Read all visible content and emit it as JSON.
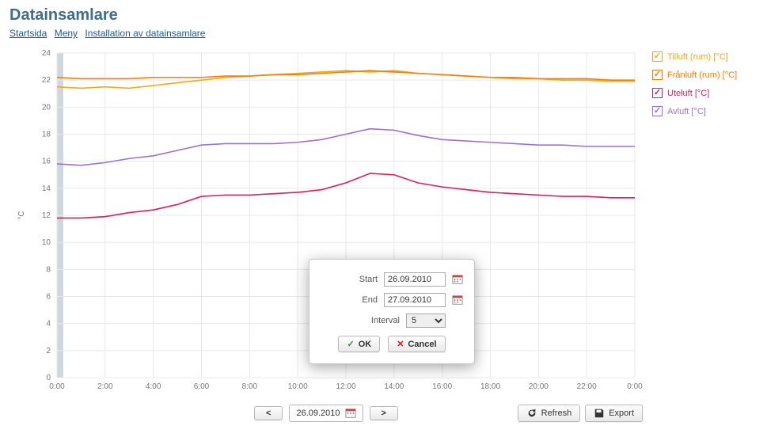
{
  "title": "Datainsamlare",
  "breadcrumbs": [
    {
      "label": "Startsida"
    },
    {
      "label": "Meny"
    },
    {
      "label": "Installation av datainsamlare"
    }
  ],
  "legend": [
    {
      "label": "Tilluft (rum) [°C]",
      "color": "#f4a90d"
    },
    {
      "label": "Frånluft (rum) [°C]",
      "color": "#ff7b00"
    },
    {
      "label": "Uteluft [°C]",
      "color": "#e11a5a"
    },
    {
      "label": "Avluft [°C]",
      "color": "#9b6fe0"
    }
  ],
  "chart_data": {
    "type": "line",
    "xlabel": "",
    "ylabel": "°C",
    "ylim": [
      0,
      24
    ],
    "yticks": [
      0,
      2,
      4,
      6,
      8,
      10,
      12,
      14,
      16,
      18,
      20,
      22,
      24
    ],
    "xcategories": [
      "0:00",
      "2:00",
      "4:00",
      "6:00",
      "8:00",
      "10:00",
      "12:00",
      "14:00",
      "16:00",
      "18:00",
      "20:00",
      "22:00",
      "0:00"
    ],
    "series": [
      {
        "name": "Tilluft (rum) [°C]",
        "color": "#f4a90d",
        "values": [
          21.5,
          21.4,
          21.5,
          21.4,
          21.6,
          21.8,
          22.0,
          22.2,
          22.3,
          22.4,
          22.5,
          22.6,
          22.7,
          22.6,
          22.7,
          22.5,
          22.4,
          22.3,
          22.2,
          22.1,
          22.1,
          22.0,
          22.0,
          21.9,
          21.9
        ]
      },
      {
        "name": "Frånluft (rum) [°C]",
        "color": "#ff7b00",
        "values": [
          22.2,
          22.1,
          22.1,
          22.1,
          22.2,
          22.2,
          22.2,
          22.3,
          22.3,
          22.4,
          22.4,
          22.5,
          22.6,
          22.7,
          22.6,
          22.5,
          22.4,
          22.3,
          22.2,
          22.2,
          22.1,
          22.1,
          22.1,
          22.0,
          22.0
        ]
      },
      {
        "name": "Uteluft [°C]",
        "color": "#e11a5a",
        "values": [
          11.8,
          11.8,
          11.9,
          12.2,
          12.4,
          12.8,
          13.4,
          13.5,
          13.5,
          13.6,
          13.7,
          13.9,
          14.4,
          15.1,
          15.0,
          14.4,
          14.1,
          13.9,
          13.7,
          13.6,
          13.5,
          13.4,
          13.4,
          13.3,
          13.3
        ]
      },
      {
        "name": "Avluft [°C]",
        "color": "#9b6fe0",
        "values": [
          15.8,
          15.7,
          15.9,
          16.2,
          16.4,
          16.8,
          17.2,
          17.3,
          17.3,
          17.3,
          17.4,
          17.6,
          18.0,
          18.4,
          18.3,
          17.9,
          17.6,
          17.5,
          17.4,
          17.3,
          17.2,
          17.2,
          17.1,
          17.1,
          17.1
        ]
      }
    ]
  },
  "toolbar": {
    "prev": "<",
    "date": "26.09.2010",
    "next": ">",
    "refresh": "Refresh",
    "export": "Export"
  },
  "dialog": {
    "start_label": "Start",
    "start_value": "26.09.2010",
    "end_label": "End",
    "end_value": "27.09.2010",
    "interval_label": "Interval",
    "interval_value": "5",
    "ok": "OK",
    "cancel": "Cancel"
  }
}
